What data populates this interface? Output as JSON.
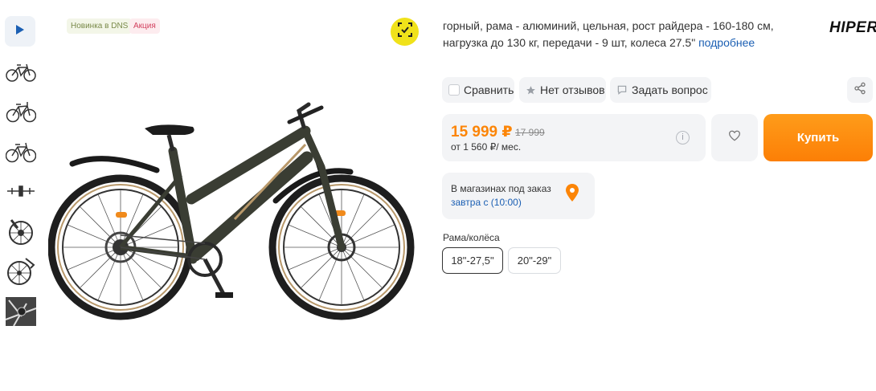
{
  "badges": {
    "new": "Новинка в DNS",
    "promo": "Акция"
  },
  "thumbnails": [
    "video-play-icon",
    "bike-side-view",
    "bike-side-view",
    "bike-side-view",
    "handlebar-view",
    "rear-wheel-closeup",
    "front-wheel-closeup",
    "pedal-closeup"
  ],
  "description": {
    "text": "горный, рама - алюминий, цельная, рост райдера - 160-180 см, нагрузка до 130 кг, передачи - 9 шт, колеса 27.5\"",
    "more_link": "подробнее"
  },
  "brand": "HIPER",
  "actions": {
    "compare": "Сравнить",
    "reviews": "Нет отзывов",
    "ask": "Задать вопрос"
  },
  "price": {
    "current": "15 999 ₽",
    "old": "17 999",
    "credit": "от 1 560 ₽/ мес.",
    "info_icon": "i"
  },
  "buy_label": "Купить",
  "stock": {
    "title": "В магазинах под заказ",
    "date": "завтра с (10:00)"
  },
  "variants": {
    "label": "Рама/колёса",
    "options": [
      "18\"-27,5\"",
      "20\"-29\""
    ]
  },
  "colors": {
    "accent": "#fc8507",
    "link": "#1b5fb3",
    "ar_button": "#f0e21a",
    "panel": "#f3f4f6"
  }
}
